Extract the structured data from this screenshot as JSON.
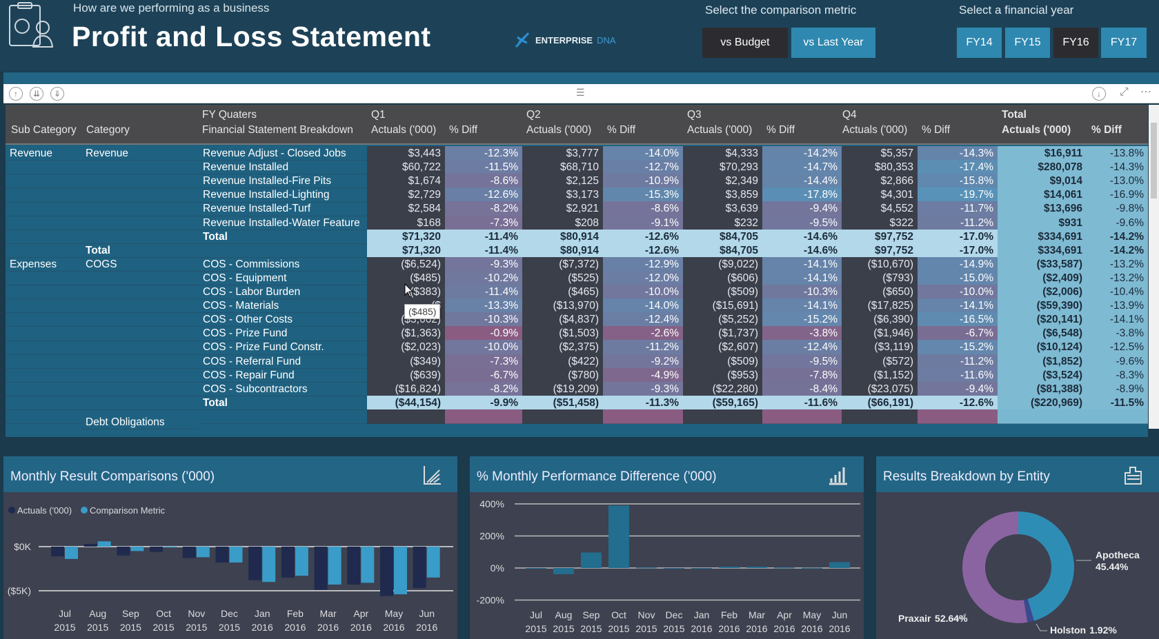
{
  "header": {
    "subtitle": "How are we performing as a business",
    "title": "Profit and Loss Statement",
    "logo_text": "ENTERPRISE",
    "logo_suffix": "DNA"
  },
  "comparison": {
    "label": "Select the comparison metric",
    "options": [
      {
        "label": "vs Budget",
        "selected": true
      },
      {
        "label": "vs Last Year",
        "selected": false
      }
    ]
  },
  "year": {
    "label": "Select a financial year",
    "options": [
      {
        "label": "FY14",
        "selected": false
      },
      {
        "label": "FY15",
        "selected": false
      },
      {
        "label": "FY16",
        "selected": true
      },
      {
        "label": "FY17",
        "selected": false
      }
    ]
  },
  "table": {
    "header_top": {
      "fy": "FY Quaters",
      "q1": "Q1",
      "q2": "Q2",
      "q3": "Q3",
      "q4": "Q4",
      "total": "Total"
    },
    "header": {
      "sub": "Sub Category",
      "cat": "Category",
      "fsb": "Financial Statement Breakdown",
      "actuals": "Actuals ('000)",
      "diff": "% Diff"
    },
    "rows": [
      {
        "sub": "Revenue",
        "cat": "Revenue",
        "name": "Revenue Adjust - Closed Jobs",
        "type": "row",
        "v": [
          "$3,443",
          "-12.3%",
          "$3,777",
          "-14.0%",
          "$4,333",
          "-14.2%",
          "$5,357",
          "-14.3%",
          "$16,911",
          "-13.8%"
        ]
      },
      {
        "sub": "",
        "cat": "",
        "name": "Revenue Installed",
        "type": "row",
        "v": [
          "$60,722",
          "-11.5%",
          "$68,710",
          "-12.7%",
          "$70,293",
          "-14.7%",
          "$80,353",
          "-17.4%",
          "$280,078",
          "-14.3%"
        ]
      },
      {
        "sub": "",
        "cat": "",
        "name": "Revenue Installed-Fire Pits",
        "type": "row",
        "v": [
          "$1,674",
          "-8.6%",
          "$2,125",
          "-10.9%",
          "$2,349",
          "-14.4%",
          "$2,866",
          "-15.8%",
          "$9,014",
          "-13.0%"
        ]
      },
      {
        "sub": "",
        "cat": "",
        "name": "Revenue Installed-Lighting",
        "type": "row",
        "v": [
          "$2,729",
          "-12.6%",
          "$3,173",
          "-15.3%",
          "$3,859",
          "-17.8%",
          "$4,301",
          "-19.7%",
          "$14,061",
          "-16.9%"
        ]
      },
      {
        "sub": "",
        "cat": "",
        "name": "Revenue Installed-Turf",
        "type": "row",
        "v": [
          "$2,584",
          "-8.2%",
          "$2,921",
          "-8.6%",
          "$3,639",
          "-9.4%",
          "$4,552",
          "-11.7%",
          "$13,696",
          "-9.8%"
        ]
      },
      {
        "sub": "",
        "cat": "",
        "name": "Revenue Installed-Water Feature",
        "type": "row",
        "v": [
          "$168",
          "-7.3%",
          "$208",
          "-9.1%",
          "$232",
          "-9.5%",
          "$322",
          "-11.2%",
          "$931",
          "-9.6%"
        ]
      },
      {
        "sub": "",
        "cat": "",
        "name": "Total",
        "type": "total",
        "v": [
          "$71,320",
          "-11.4%",
          "$80,914",
          "-12.6%",
          "$84,705",
          "-14.6%",
          "$97,752",
          "-17.0%",
          "$334,691",
          "-14.2%"
        ]
      },
      {
        "sub": "",
        "cat": "Total",
        "name": "",
        "type": "total",
        "v": [
          "$71,320",
          "-11.4%",
          "$80,914",
          "-12.6%",
          "$84,705",
          "-14.6%",
          "$97,752",
          "-17.0%",
          "$334,691",
          "-14.2%"
        ]
      },
      {
        "sub": "Expenses",
        "cat": "COGS",
        "name": "COS - Commissions",
        "type": "row",
        "v": [
          "($6,524)",
          "-9.3%",
          "($7,372)",
          "-12.9%",
          "($9,022)",
          "-14.1%",
          "($10,670)",
          "-14.9%",
          "($33,587)",
          "-13.2%"
        ]
      },
      {
        "sub": "",
        "cat": "",
        "name": "COS - Equipment",
        "type": "row",
        "v": [
          "($485)",
          "-10.2%",
          "($525)",
          "-12.0%",
          "($606)",
          "-14.1%",
          "($793)",
          "-15.0%",
          "($2,409)",
          "-13.2%"
        ]
      },
      {
        "sub": "",
        "cat": "",
        "name": "COS - Labor Burden",
        "type": "row",
        "v": [
          "($383)",
          "-11.4%",
          "($465)",
          "-10.0%",
          "($509)",
          "-10.3%",
          "($650)",
          "-10.0%",
          "($2,006)",
          "-10.4%"
        ]
      },
      {
        "sub": "",
        "cat": "",
        "name": "COS - Materials",
        "type": "row",
        "v": [
          "($",
          "-13.3%",
          "($13,970)",
          "-14.0%",
          "($15,691)",
          "-14.1%",
          "($17,825)",
          "-14.1%",
          "($59,390)",
          "-13.9%"
        ]
      },
      {
        "sub": "",
        "cat": "",
        "name": "COS - Other Costs",
        "type": "row",
        "v": [
          "($3,662)",
          "-10.3%",
          "($4,837)",
          "-12.4%",
          "($5,252)",
          "-15.2%",
          "($6,390)",
          "-16.5%",
          "($20,141)",
          "-14.1%"
        ]
      },
      {
        "sub": "",
        "cat": "",
        "name": "COS - Prize Fund",
        "type": "row",
        "v": [
          "($1,363)",
          "-0.9%",
          "($1,503)",
          "-2.6%",
          "($1,737)",
          "-3.8%",
          "($1,946)",
          "-6.7%",
          "($6,548)",
          "-3.8%"
        ]
      },
      {
        "sub": "",
        "cat": "",
        "name": "COS - Prize Fund Constr.",
        "type": "row",
        "v": [
          "($2,023)",
          "-10.0%",
          "($2,375)",
          "-11.2%",
          "($2,607)",
          "-12.4%",
          "($3,119)",
          "-15.2%",
          "($10,124)",
          "-12.5%"
        ]
      },
      {
        "sub": "",
        "cat": "",
        "name": "COS - Referral Fund",
        "type": "row",
        "v": [
          "($349)",
          "-7.3%",
          "($422)",
          "-9.2%",
          "($509)",
          "-9.5%",
          "($572)",
          "-11.2%",
          "($1,852)",
          "-9.6%"
        ]
      },
      {
        "sub": "",
        "cat": "",
        "name": "COS - Repair Fund",
        "type": "row",
        "v": [
          "($639)",
          "-6.7%",
          "($780)",
          "-4.9%",
          "($953)",
          "-7.8%",
          "($1,152)",
          "-11.6%",
          "($3,524)",
          "-8.3%"
        ]
      },
      {
        "sub": "",
        "cat": "",
        "name": "COS - Subcontractors",
        "type": "row",
        "v": [
          "($16,824)",
          "-8.2%",
          "($19,209)",
          "-9.3%",
          "($22,280)",
          "-8.4%",
          "($23,075)",
          "-9.4%",
          "($81,388)",
          "-8.9%"
        ]
      },
      {
        "sub": "",
        "cat": "",
        "name": "Total",
        "type": "total",
        "v": [
          "($44,154)",
          "-9.9%",
          "($51,458)",
          "-11.3%",
          "($59,165)",
          "-11.6%",
          "($66,191)",
          "-12.6%",
          "($220,969)",
          "-11.5%"
        ]
      },
      {
        "sub": "",
        "cat": "Debt Obligations",
        "name": "",
        "type": "partial",
        "v": [
          "",
          "",
          "",
          "",
          "",
          "",
          "",
          "",
          "",
          ""
        ]
      }
    ],
    "tooltip": "($485)"
  },
  "colors": {
    "accent": "#2f88b0",
    "header_bg": "#1d4258",
    "panel_head": "#236585",
    "actuals_dark": "#1f2a4e",
    "comparison": "#3a9cc8",
    "perf_bar": "#236d8e",
    "apotheca": "#2e8db5",
    "praxair": "#8a64a0",
    "holston": "#3a4a90"
  },
  "chart_data": [
    {
      "type": "bar",
      "title": "Monthly Result Comparisons ('000)",
      "categories": [
        "Jul 2015",
        "Aug 2015",
        "Sep 2015",
        "Oct 2015",
        "Nov 2015",
        "Dec 2015",
        "Jan 2016",
        "Feb 2016",
        "Mar 2016",
        "Apr 2016",
        "May 2016",
        "Jun 2016"
      ],
      "series": [
        {
          "name": "Actuals ('000)",
          "values": [
            -1.1,
            0.3,
            -1.0,
            -0.6,
            -1.3,
            -1.8,
            -3.8,
            -3.5,
            -4.9,
            -4.3,
            -5.6,
            -4.7
          ]
        },
        {
          "name": "Comparison Metric",
          "values": [
            -1.4,
            0.6,
            -0.5,
            -0.1,
            -1.2,
            -1.8,
            -4.0,
            -3.3,
            -4.3,
            -4.1,
            -5.4,
            -3.5
          ]
        }
      ],
      "yticks": [
        "$0K",
        "($5K)"
      ],
      "ylim": [
        -5.8,
        1.5
      ],
      "legend": "top-left",
      "grid": true
    },
    {
      "type": "bar",
      "title": "% Monthly Performance Difference ('000)",
      "categories": [
        "Jul 2015",
        "Aug 2015",
        "Sep 2015",
        "Oct 2015",
        "Nov 2015",
        "Dec 2015",
        "Jan 2016",
        "Feb 2016",
        "Mar 2016",
        "Apr 2016",
        "May 2016",
        "Jun 2016"
      ],
      "values": [
        0,
        -39,
        97,
        390,
        3,
        0,
        0,
        8,
        8,
        3,
        1,
        37
      ],
      "yticks": [
        "400%",
        "200%",
        "0%",
        "-200%"
      ],
      "ylim": [
        -200,
        400
      ],
      "grid": true
    },
    {
      "type": "pie",
      "title": "Results Breakdown by Entity",
      "donut": true,
      "slices": [
        {
          "label": "Apotheca",
          "value": 45.44,
          "text": "45.44%"
        },
        {
          "label": "Holston",
          "value": 1.92,
          "text": "1.92%"
        },
        {
          "label": "Praxair",
          "value": 52.64,
          "text": "52.64%"
        }
      ]
    }
  ]
}
